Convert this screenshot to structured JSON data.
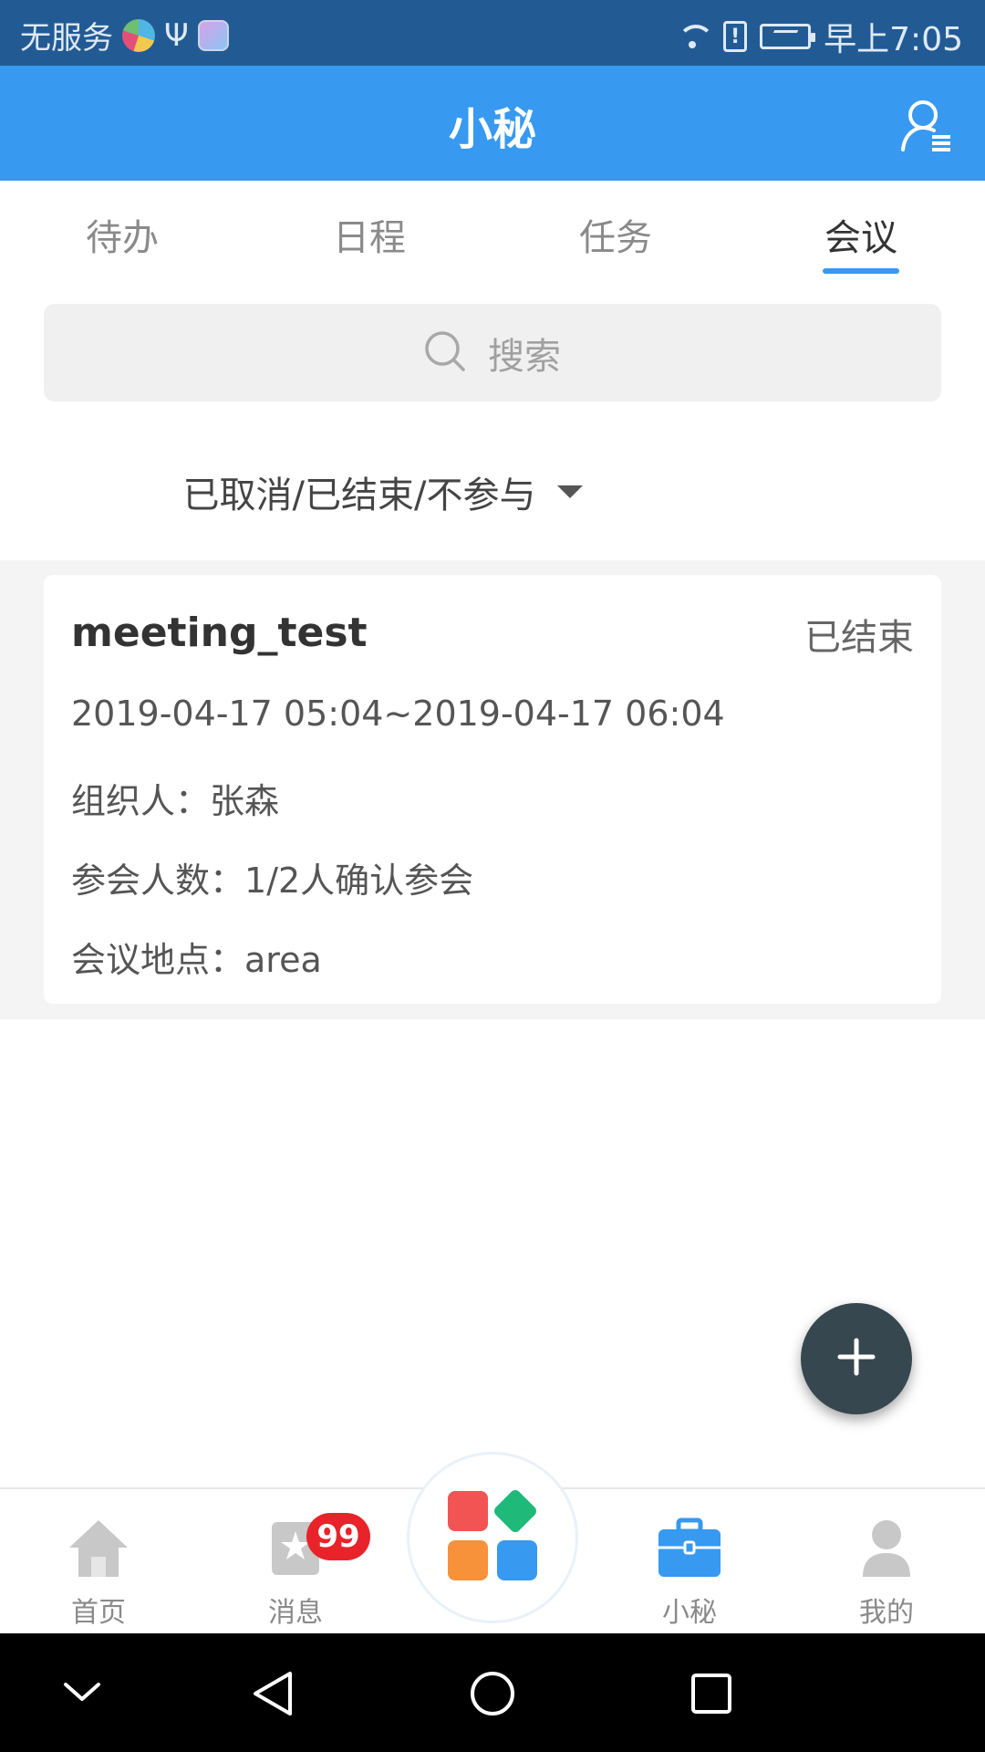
{
  "status_bar": {
    "carrier_text": "无服务",
    "time": "早上7:05",
    "icons": [
      "app-logo-icon",
      "usb-icon",
      "app-square-icon",
      "wifi-icon",
      "sim-alert-icon",
      "battery-charging-icon"
    ]
  },
  "header": {
    "title": "小秘",
    "right_icon": "user-list-icon"
  },
  "tabs": [
    {
      "label": "待办",
      "active": false
    },
    {
      "label": "日程",
      "active": false
    },
    {
      "label": "任务",
      "active": false
    },
    {
      "label": "会议",
      "active": true
    }
  ],
  "search": {
    "placeholder": "搜索",
    "icon": "search-icon"
  },
  "filter": {
    "label": "已取消/已结束/不参与",
    "icon": "caret-down-icon"
  },
  "meetings": [
    {
      "title": "meeting_test",
      "status": "已结束",
      "time_range": "2019-04-17 05:04~2019-04-17 06:04",
      "organizer_label": "组织人：",
      "organizer": "张森",
      "attendees_label": "参会人数：",
      "attendees": "1/2人确认参会",
      "location_label": "会议地点：",
      "location": "area"
    }
  ],
  "fab": {
    "icon": "plus-icon"
  },
  "bottom_nav": {
    "items": [
      {
        "label": "首页",
        "icon": "home-icon",
        "active": false
      },
      {
        "label": "消息",
        "icon": "message-icon",
        "active": false,
        "badge": "99"
      },
      {
        "label": "",
        "icon": "apps-grid-icon",
        "active": false
      },
      {
        "label": "小秘",
        "icon": "briefcase-icon",
        "active": true
      },
      {
        "label": "我的",
        "icon": "profile-icon",
        "active": false
      }
    ]
  },
  "colors": {
    "status_bar": "#225b94",
    "primary": "#3799f0",
    "fab": "#37474f",
    "badge": "#e8232a"
  }
}
